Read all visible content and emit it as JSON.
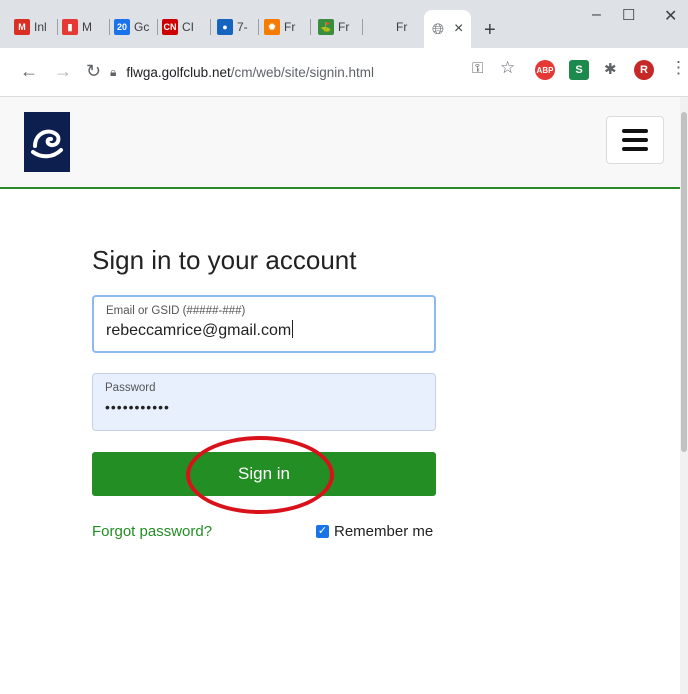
{
  "browser": {
    "tabs": [
      {
        "title": "Inl",
        "favicon": "gmail-icon",
        "color": "#d93025",
        "glyph": "M"
      },
      {
        "title": "M",
        "favicon": "meetup-icon",
        "color": "#e53935",
        "glyph": "▮"
      },
      {
        "title": "Gc",
        "favicon": "calendar-icon",
        "color": "#1a73e8",
        "glyph": "20"
      },
      {
        "title": "CI",
        "favicon": "cnn-icon",
        "color": "#cc0000",
        "glyph": "CN"
      },
      {
        "title": "7-",
        "favicon": "weather-icon",
        "color": "#1565c0",
        "glyph": "●"
      },
      {
        "title": "Fr",
        "favicon": "sun-icon",
        "color": "#f57c00",
        "glyph": "✹"
      },
      {
        "title": "Fr",
        "favicon": "golf-icon",
        "color": "#388e3c",
        "glyph": "⛳"
      },
      {
        "title": "Fr",
        "favicon": "",
        "color": "",
        "glyph": ""
      }
    ],
    "active_tab": {
      "close": "×",
      "favicon": "globe-icon"
    },
    "new_tab": "+",
    "window_controls": {
      "minimize": "–",
      "maximize": "☐",
      "close": "✕"
    },
    "nav": {
      "back": "←",
      "forward": "→",
      "reload": "↻"
    },
    "url": {
      "host": "flwga.golfclub.net",
      "path": "/cm/web/site/signin.html"
    },
    "toolbar_icons": {
      "key": "⚿",
      "star": "☆",
      "abp": "ABP",
      "ext_s": "S",
      "puzzle": "✱",
      "profile": "R",
      "menu": "⋮"
    }
  },
  "page": {
    "title": "Sign in to your account",
    "email": {
      "label": "Email or GSID (#####-###)",
      "value": "rebeccamrice@gmail.com"
    },
    "password": {
      "label": "Password",
      "value": "•••••••••••"
    },
    "signin_label": "Sign in",
    "forgot_label": "Forgot password?",
    "remember_label": "Remember me",
    "remember_checked": true
  },
  "colors": {
    "accent_green": "#238e23",
    "logo_navy": "#0d1f4f",
    "annotation_red": "#d9111a"
  }
}
